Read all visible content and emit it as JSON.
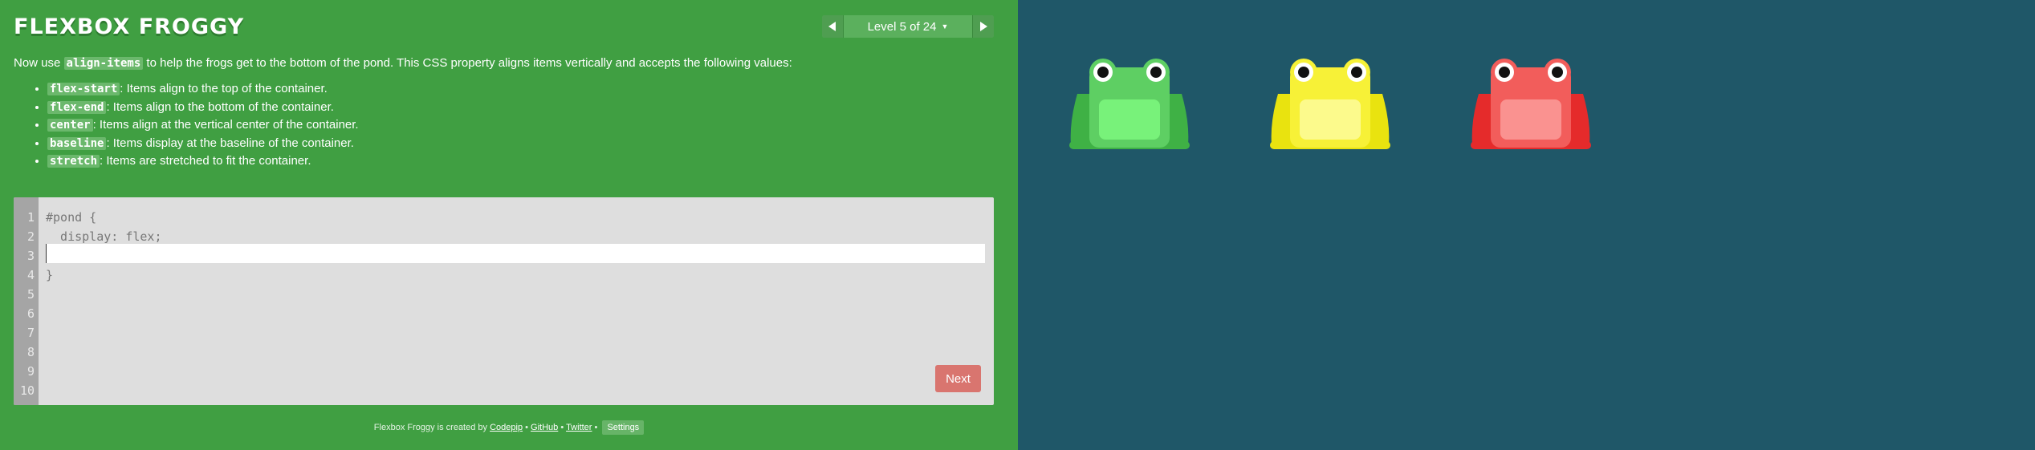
{
  "app": {
    "title": "FLEXBOX FROGGY",
    "level_label": "Level 5 of 24"
  },
  "instructions": {
    "intro_before": "Now use ",
    "intro_code": "align-items",
    "intro_after": " to help the frogs get to the bottom of the pond. This CSS property aligns items vertically and accepts the following values:",
    "values": [
      {
        "code": "flex-start",
        "desc": ": Items align to the top of the container."
      },
      {
        "code": "flex-end",
        "desc": ": Items align to the bottom of the container."
      },
      {
        "code": "center",
        "desc": ": Items align at the vertical center of the container."
      },
      {
        "code": "baseline",
        "desc": ": Items display at the baseline of the container."
      },
      {
        "code": "stretch",
        "desc": ": Items are stretched to fit the container."
      }
    ]
  },
  "editor": {
    "line_numbers": [
      "1",
      "2",
      "3",
      "4",
      "5",
      "6",
      "7",
      "8",
      "9",
      "10"
    ],
    "line1": "#pond {",
    "line2": "  display: flex;",
    "line3_value": "",
    "line4": "}",
    "next_label": "Next"
  },
  "footer": {
    "created_text": "Flexbox Froggy is created by ",
    "codepip": "Codepip",
    "sep1": " • ",
    "github": "GitHub",
    "sep2": " • ",
    "twitter": "Twitter",
    "sep3": " • ",
    "settings": "Settings"
  },
  "frogs": [
    {
      "color": "green",
      "body": "#5ecf63",
      "legs": "#3fb145",
      "belly": "#78f27a"
    },
    {
      "color": "yellow",
      "body": "#f7f137",
      "legs": "#e9e30f",
      "belly": "#fcfa8c"
    },
    {
      "color": "red",
      "body": "#f25d5b",
      "legs": "#e52b2b",
      "belly": "#fa9290"
    }
  ],
  "colors": {
    "sidebar_bg": "#409f42",
    "pond_bg": "#1f5768",
    "next_button": "#d9756f"
  }
}
